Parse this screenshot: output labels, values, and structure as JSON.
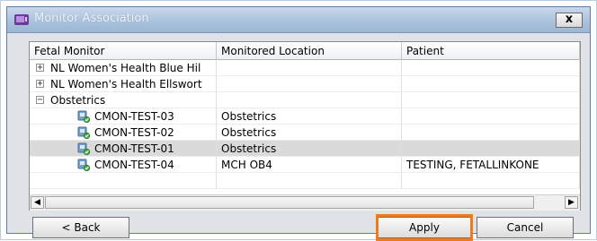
{
  "window": {
    "title": "Monitor Association",
    "close_label": "x"
  },
  "table": {
    "columns": [
      "Fetal Monitor",
      "Monitored Location",
      "Patient"
    ],
    "rows": [
      {
        "toggle": "+",
        "monitor": "NL Women's Health Blue Hil",
        "location": "",
        "patient": ""
      },
      {
        "toggle": "+",
        "monitor": "NL Women's Health Ellswort",
        "location": "",
        "patient": ""
      },
      {
        "toggle": "−",
        "monitor": "Obstetrics",
        "location": "",
        "patient": ""
      },
      {
        "monitor": "CMON-TEST-03",
        "location": "Obstetrics",
        "patient": ""
      },
      {
        "monitor": "CMON-TEST-02",
        "location": "Obstetrics",
        "patient": ""
      },
      {
        "monitor": "CMON-TEST-01",
        "location": "Obstetrics",
        "patient": "",
        "selected": true
      },
      {
        "monitor": "CMON-TEST-04",
        "location": "MCH OB4",
        "patient": "TESTING, FETALLINKONE"
      }
    ]
  },
  "scrollbar": {
    "left_arrow": "◀",
    "right_arrow": "▶"
  },
  "buttons": {
    "back": "< Back",
    "apply": "Apply",
    "cancel": "Cancel"
  },
  "icons": {
    "app": "monitor-app-icon",
    "device": "monitor-device-icon"
  },
  "colors": {
    "focus_highlight": "#f07b1f",
    "selected_row": "#dadada",
    "title_bar": "#a9c1dc"
  }
}
